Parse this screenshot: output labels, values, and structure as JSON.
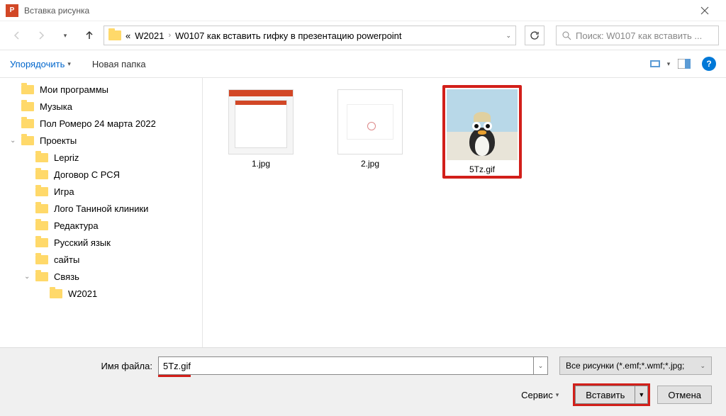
{
  "titlebar": {
    "title": "Вставка рисунка"
  },
  "nav": {
    "path_prefix": "«",
    "crumb1": "W2021",
    "crumb2": "W0107 как вставить гифку в презентацию powerpoint",
    "search_placeholder": "Поиск: W0107 как вставить ..."
  },
  "toolbar": {
    "organize": "Упорядочить",
    "new_folder": "Новая папка"
  },
  "tree": [
    {
      "label": "Мои программы",
      "lvl": 0
    },
    {
      "label": "Музыка",
      "lvl": 0
    },
    {
      "label": "Пол Ромеро 24 марта 2022",
      "lvl": 0
    },
    {
      "label": "Проекты",
      "lvl": 0,
      "expand": true
    },
    {
      "label": "Lepriz",
      "lvl": 1
    },
    {
      "label": "Договор С РСЯ",
      "lvl": 1
    },
    {
      "label": "Игра",
      "lvl": 1
    },
    {
      "label": "Лого Таниной клиники",
      "lvl": 1
    },
    {
      "label": "Редактура",
      "lvl": 1
    },
    {
      "label": "Русский язык",
      "lvl": 1
    },
    {
      "label": "сайты",
      "lvl": 1
    },
    {
      "label": "Связь",
      "lvl": 1,
      "expand": true
    },
    {
      "label": "W2021",
      "lvl": 2
    }
  ],
  "files": [
    {
      "name": "1.jpg"
    },
    {
      "name": "2.jpg"
    },
    {
      "name": "5Tz.gif"
    }
  ],
  "footer": {
    "filename_label": "Имя файла:",
    "filename_value": "5Tz.gif",
    "filetype": "Все рисунки (*.emf;*.wmf;*.jpg;",
    "service": "Сервис",
    "insert": "Вставить",
    "cancel": "Отмена"
  }
}
